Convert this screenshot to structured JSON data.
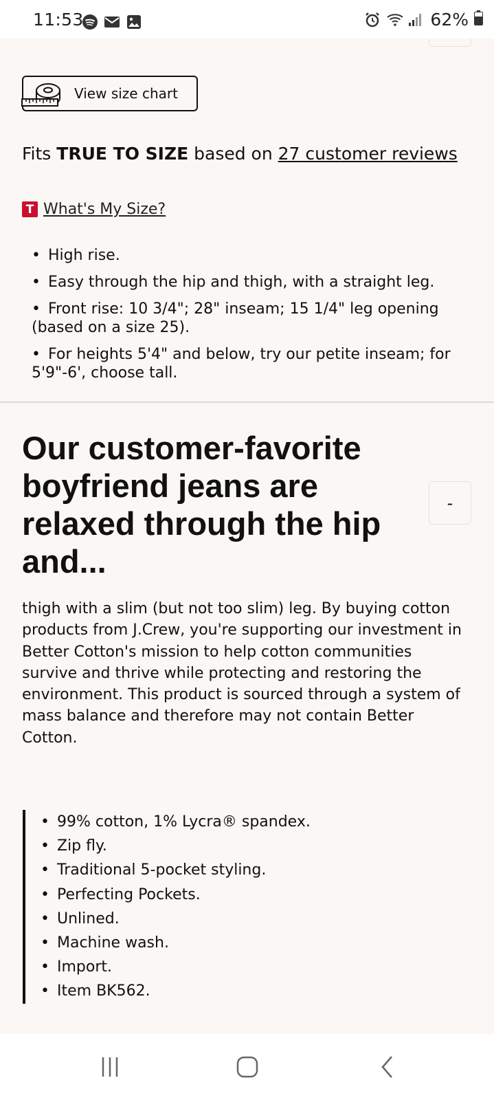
{
  "status_bar": {
    "time": "11:53",
    "battery": "62%",
    "left_icons": [
      "spotify-icon",
      "gmail-icon",
      "gallery-icon"
    ],
    "right_icons": [
      "alarm-icon",
      "wifi-icon",
      "signal-icon",
      "battery-icon"
    ]
  },
  "size_chart": {
    "button_label": "View size chart",
    "icon": "measuring-tape-icon"
  },
  "fit": {
    "prefix": "Fits ",
    "verdict": "TRUE TO SIZE",
    "middle": " based on ",
    "reviews_link": "27 customer reviews"
  },
  "whats_my_size": {
    "badge": "T",
    "label": "What's My Size?"
  },
  "fit_details": [
    "High rise.",
    "Easy through the hip and thigh, with a straight leg.",
    "Front rise: 10 3/4\"; 28\" inseam; 15 1/4\" leg opening (based on a size 25).",
    "For heights 5'4\" and below, try our petite inseam; for 5'9\"-6', choose tall."
  ],
  "details_section": {
    "headline": "Our customer-favorite boyfriend jeans are relaxed through the hip and...",
    "toggle_label": "-",
    "description": "thigh with a slim (but not too slim) leg. By buying cotton products from J.Crew, you're supporting our investment in Better Cotton's mission to help cotton communities survive and thrive while protecting and restoring the environment. This product is sourced through a system of mass balance and therefore may not contain Better Cotton.",
    "features": [
      "99% cotton, 1% Lycra® spandex.",
      "Zip fly.",
      "Traditional 5-pocket styling.",
      "Perfecting Pockets.",
      "Unlined.",
      "Machine wash.",
      "Import.",
      "Item BK562."
    ]
  },
  "nav_bar": {
    "buttons": [
      "recent-apps-icon",
      "home-icon",
      "back-icon"
    ]
  },
  "colors": {
    "page_background": "#faf7f4",
    "badge_red": "#c8102e",
    "text": "#111111"
  }
}
